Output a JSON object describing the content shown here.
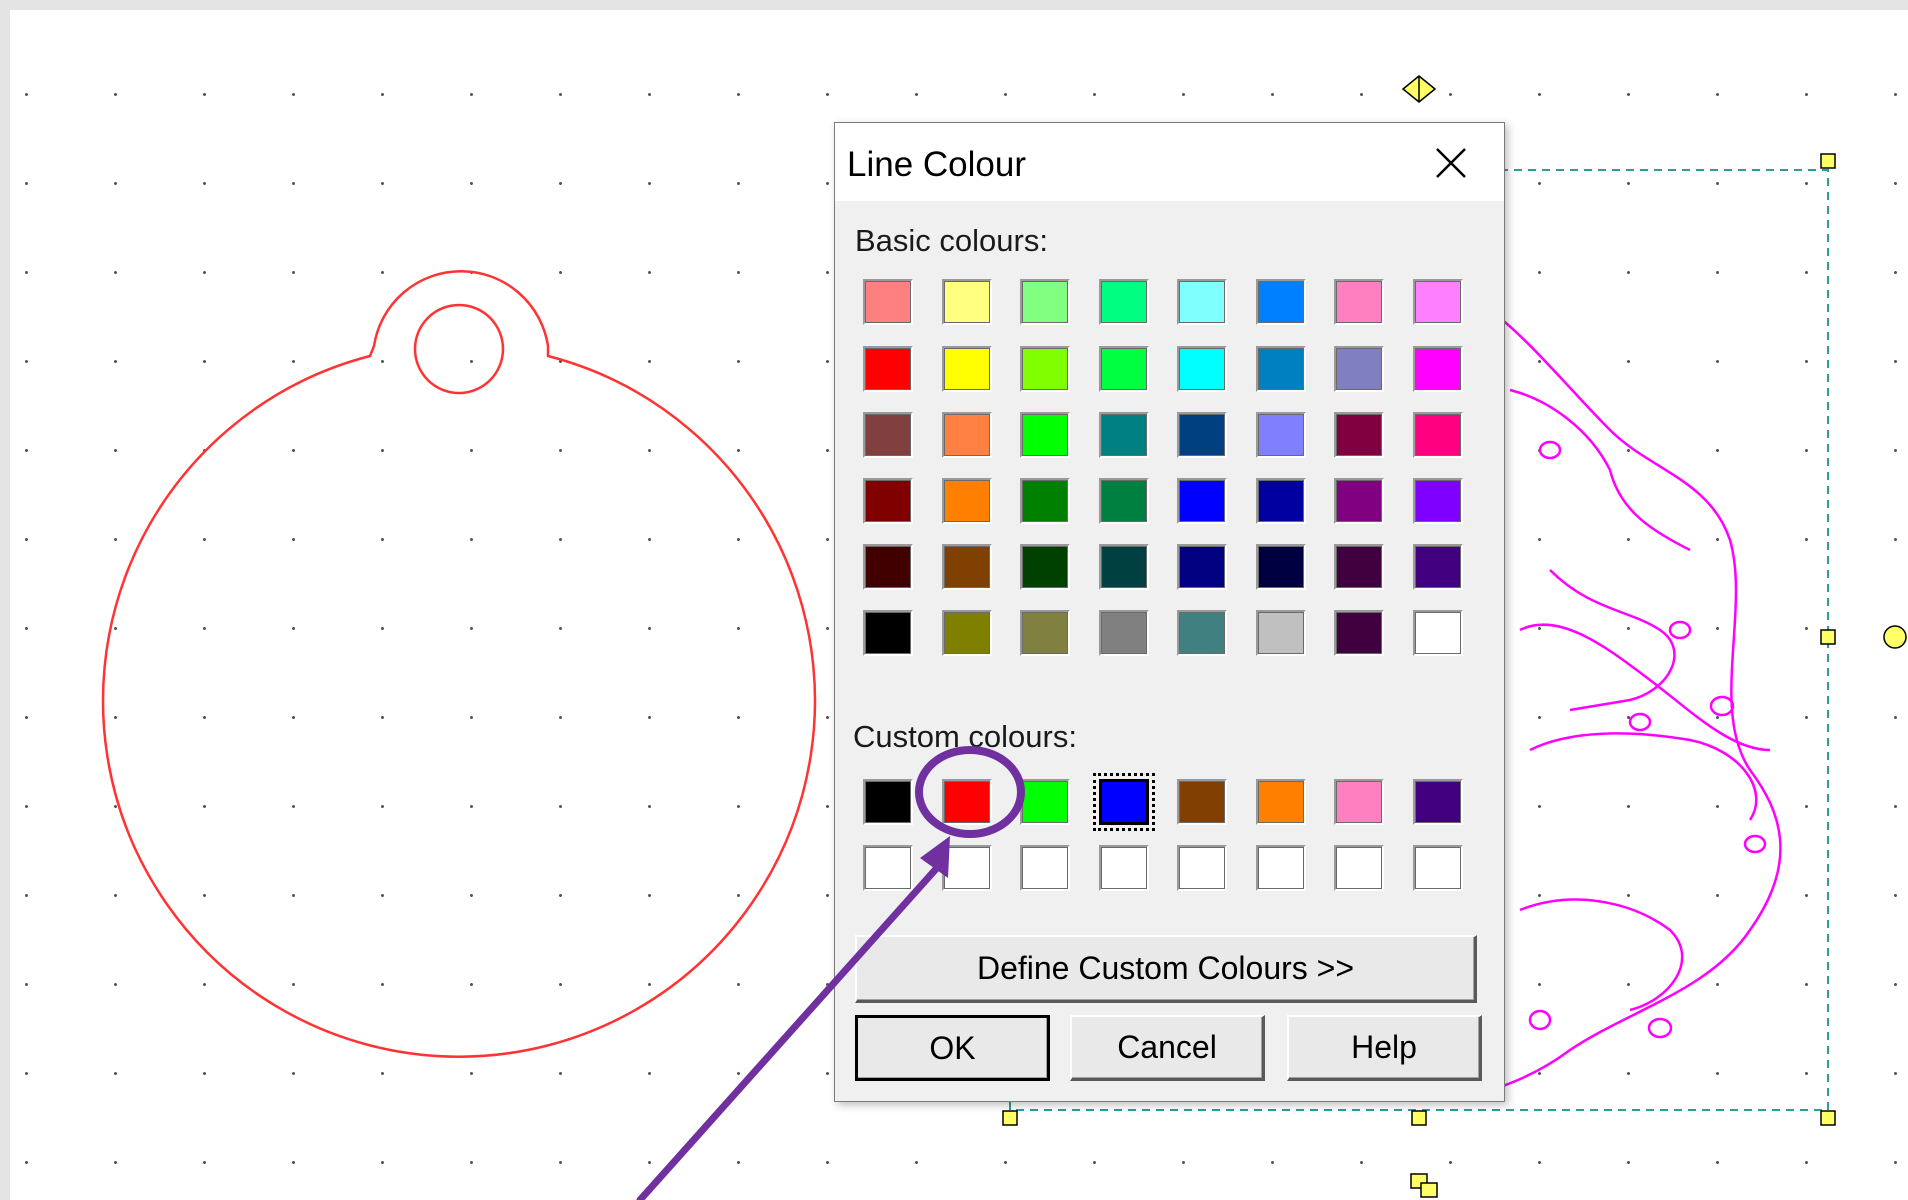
{
  "dialog": {
    "title": "Line Colour",
    "basic_label": "Basic colours:",
    "custom_label": "Custom colours:",
    "define_label": "Define Custom Colours >>",
    "ok_label": "OK",
    "cancel_label": "Cancel",
    "help_label": "Help",
    "basic_colours": [
      [
        "#ff8080",
        "#ffff80",
        "#80ff80",
        "#00ff80",
        "#80ffff",
        "#0080ff",
        "#ff80c0",
        "#ff80ff"
      ],
      [
        "#ff0000",
        "#ffff00",
        "#80ff00",
        "#00ff40",
        "#00ffff",
        "#0080c0",
        "#8080c0",
        "#ff00ff"
      ],
      [
        "#804040",
        "#ff8040",
        "#00ff00",
        "#008080",
        "#004080",
        "#8080ff",
        "#800040",
        "#ff0080"
      ],
      [
        "#800000",
        "#ff8000",
        "#008000",
        "#008040",
        "#0000ff",
        "#0000a0",
        "#800080",
        "#8000ff"
      ],
      [
        "#400000",
        "#804000",
        "#004000",
        "#004040",
        "#000080",
        "#000040",
        "#400040",
        "#400080"
      ],
      [
        "#000000",
        "#808000",
        "#808040",
        "#808080",
        "#408080",
        "#c0c0c0",
        "#400040",
        "#ffffff"
      ]
    ],
    "custom_colours": [
      [
        "#000000",
        "#ff0000",
        "#00ff00",
        "#0000ff",
        "#804000",
        "#ff8000",
        "#ff80c0",
        "#400080"
      ],
      [
        "#ffffff",
        "#ffffff",
        "#ffffff",
        "#ffffff",
        "#ffffff",
        "#ffffff",
        "#ffffff",
        "#ffffff"
      ]
    ],
    "selected_custom": [
      0,
      3
    ],
    "highlighted_custom": [
      0,
      1
    ]
  },
  "colors": {
    "ornament_outline": "#ff3333",
    "text_artwork": "#ff00ff",
    "selection_box": "#2a9d9d",
    "handle_fill": "#ffff66",
    "annotation": "#7030a0"
  }
}
